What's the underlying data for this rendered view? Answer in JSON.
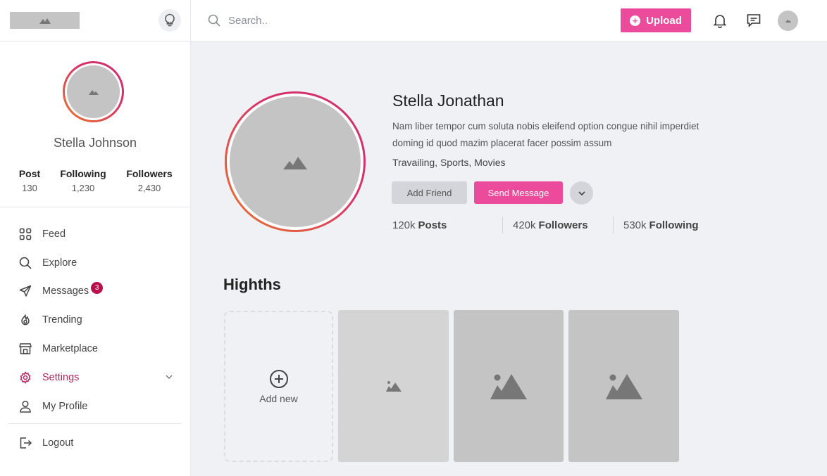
{
  "header": {
    "search_placeholder": "Search..",
    "upload_label": "Upload"
  },
  "sidebar": {
    "user_name": "Stella Johnson",
    "stats": [
      {
        "label": "Post",
        "value": "130"
      },
      {
        "label": "Following",
        "value": "1,230"
      },
      {
        "label": "Followers",
        "value": "2,430"
      }
    ],
    "nav": [
      {
        "label": "Feed",
        "icon": "grid-icon"
      },
      {
        "label": "Explore",
        "icon": "search-icon"
      },
      {
        "label": "Messages",
        "icon": "send-icon",
        "badge": "3"
      },
      {
        "label": "Trending",
        "icon": "flame-icon"
      },
      {
        "label": "Marketplace",
        "icon": "store-icon"
      },
      {
        "label": "Settings",
        "icon": "gear-icon",
        "active": true
      },
      {
        "label": "My Profile",
        "icon": "user-icon"
      },
      {
        "label": "Logout",
        "icon": "logout-icon"
      }
    ]
  },
  "profile": {
    "name": "Stella Jonathan",
    "bio": "Nam liber tempor cum soluta nobis eleifend option congue nihil imperdiet doming id quod mazim placerat facer possim assum",
    "tags": "Travailing,  Sports,  Movies",
    "add_friend_label": "Add Friend",
    "send_message_label": "Send Message",
    "stats": [
      {
        "value": "120k",
        "label": "Posts"
      },
      {
        "value": "420k",
        "label": "Followers"
      },
      {
        "value": "530k",
        "label": "Following"
      }
    ]
  },
  "highlights": {
    "title": "Highths",
    "add_new_label": "Add new"
  },
  "colors": {
    "accent": "#ec4a9a",
    "active_nav": "#b5245c",
    "placeholder": "#c4c4c4"
  }
}
